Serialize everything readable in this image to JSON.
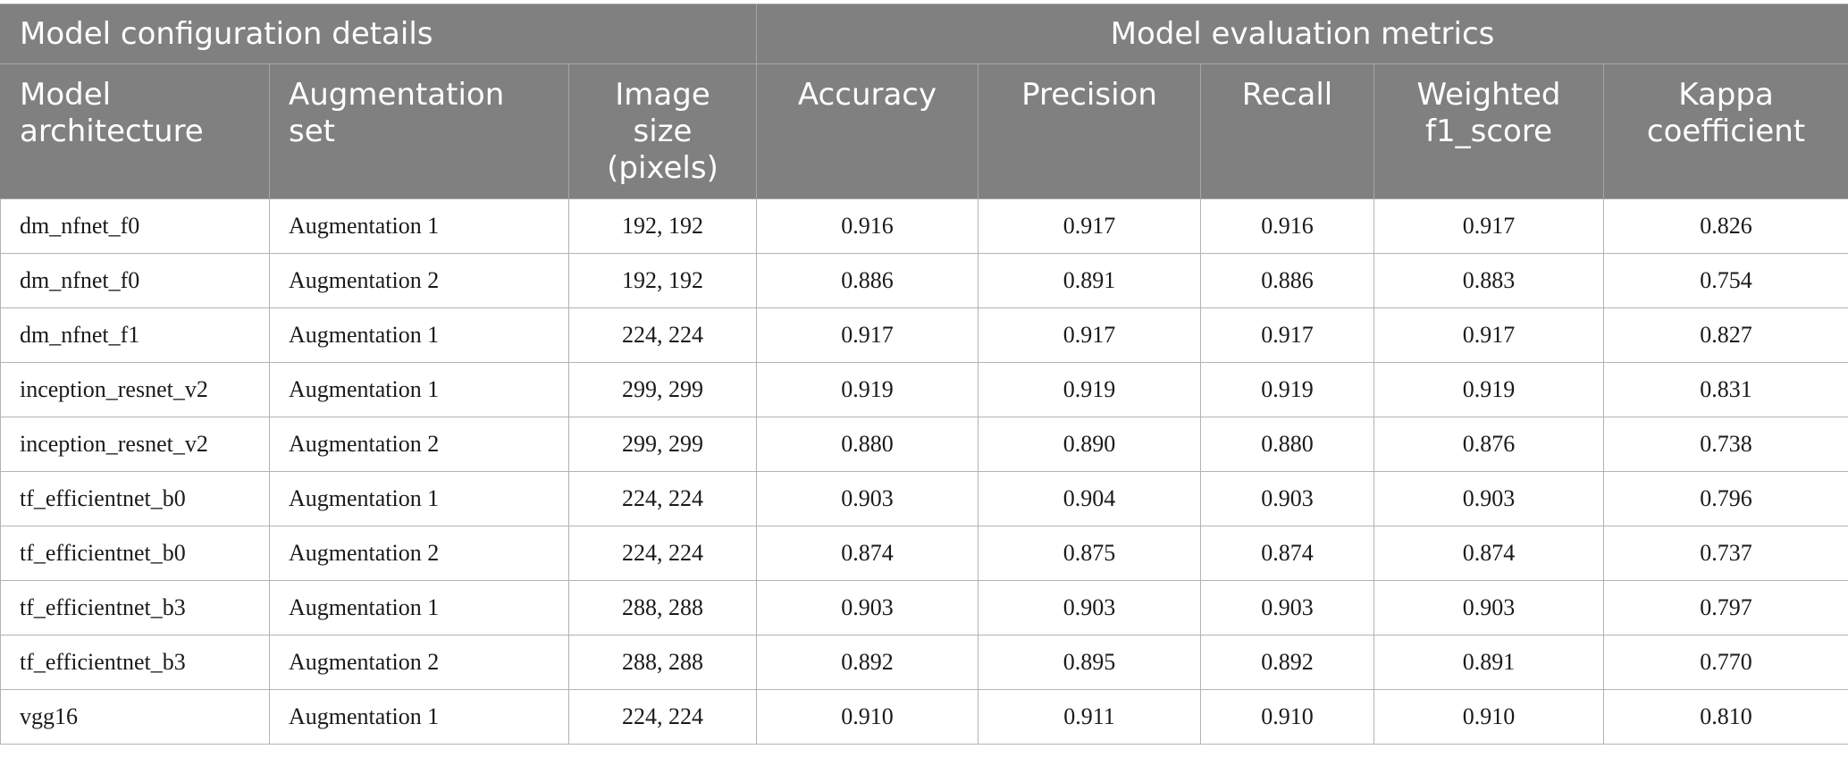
{
  "table": {
    "group_headers": {
      "config": "Model configuration details",
      "metrics": "Model evaluation metrics"
    },
    "columns": [
      {
        "label": "Model architecture",
        "lines": [
          "Model",
          "architecture"
        ]
      },
      {
        "label": "Augmentation set",
        "lines": [
          "Augmentation",
          "set"
        ]
      },
      {
        "label": "Image size (pixels)",
        "lines": [
          "Image",
          "size",
          "(pixels)"
        ]
      },
      {
        "label": "Accuracy",
        "lines": [
          "Accuracy"
        ]
      },
      {
        "label": "Precision",
        "lines": [
          "Precision"
        ]
      },
      {
        "label": "Recall",
        "lines": [
          "Recall"
        ]
      },
      {
        "label": "Weighted f1_score",
        "lines": [
          "Weighted",
          "f1_score"
        ]
      },
      {
        "label": "Kappa coefficient",
        "lines": [
          "Kappa",
          "coefficient"
        ]
      }
    ],
    "rows": [
      [
        "dm_nfnet_f0",
        "Augmentation 1",
        "192, 192",
        "0.916",
        "0.917",
        "0.916",
        "0.917",
        "0.826"
      ],
      [
        "dm_nfnet_f0",
        "Augmentation 2",
        "192, 192",
        "0.886",
        "0.891",
        "0.886",
        "0.883",
        "0.754"
      ],
      [
        "dm_nfnet_f1",
        "Augmentation 1",
        "224, 224",
        "0.917",
        "0.917",
        "0.917",
        "0.917",
        "0.827"
      ],
      [
        "inception_resnet_v2",
        "Augmentation 1",
        "299, 299",
        "0.919",
        "0.919",
        "0.919",
        "0.919",
        "0.831"
      ],
      [
        "inception_resnet_v2",
        "Augmentation 2",
        "299, 299",
        "0.880",
        "0.890",
        "0.880",
        "0.876",
        "0.738"
      ],
      [
        "tf_efficientnet_b0",
        "Augmentation 1",
        "224, 224",
        "0.903",
        "0.904",
        "0.903",
        "0.903",
        "0.796"
      ],
      [
        "tf_efficientnet_b0",
        "Augmentation 2",
        "224, 224",
        "0.874",
        "0.875",
        "0.874",
        "0.874",
        "0.737"
      ],
      [
        "tf_efficientnet_b3",
        "Augmentation 1",
        "288, 288",
        "0.903",
        "0.903",
        "0.903",
        "0.903",
        "0.797"
      ],
      [
        "tf_efficientnet_b3",
        "Augmentation 2",
        "288, 288",
        "0.892",
        "0.895",
        "0.892",
        "0.891",
        "0.770"
      ],
      [
        "vgg16",
        "Augmentation 1",
        "224, 224",
        "0.910",
        "0.911",
        "0.910",
        "0.910",
        "0.810"
      ]
    ]
  },
  "colors": {
    "header_bg": "#808080",
    "header_text": "#ffffff",
    "border": "#b3b3b3"
  }
}
